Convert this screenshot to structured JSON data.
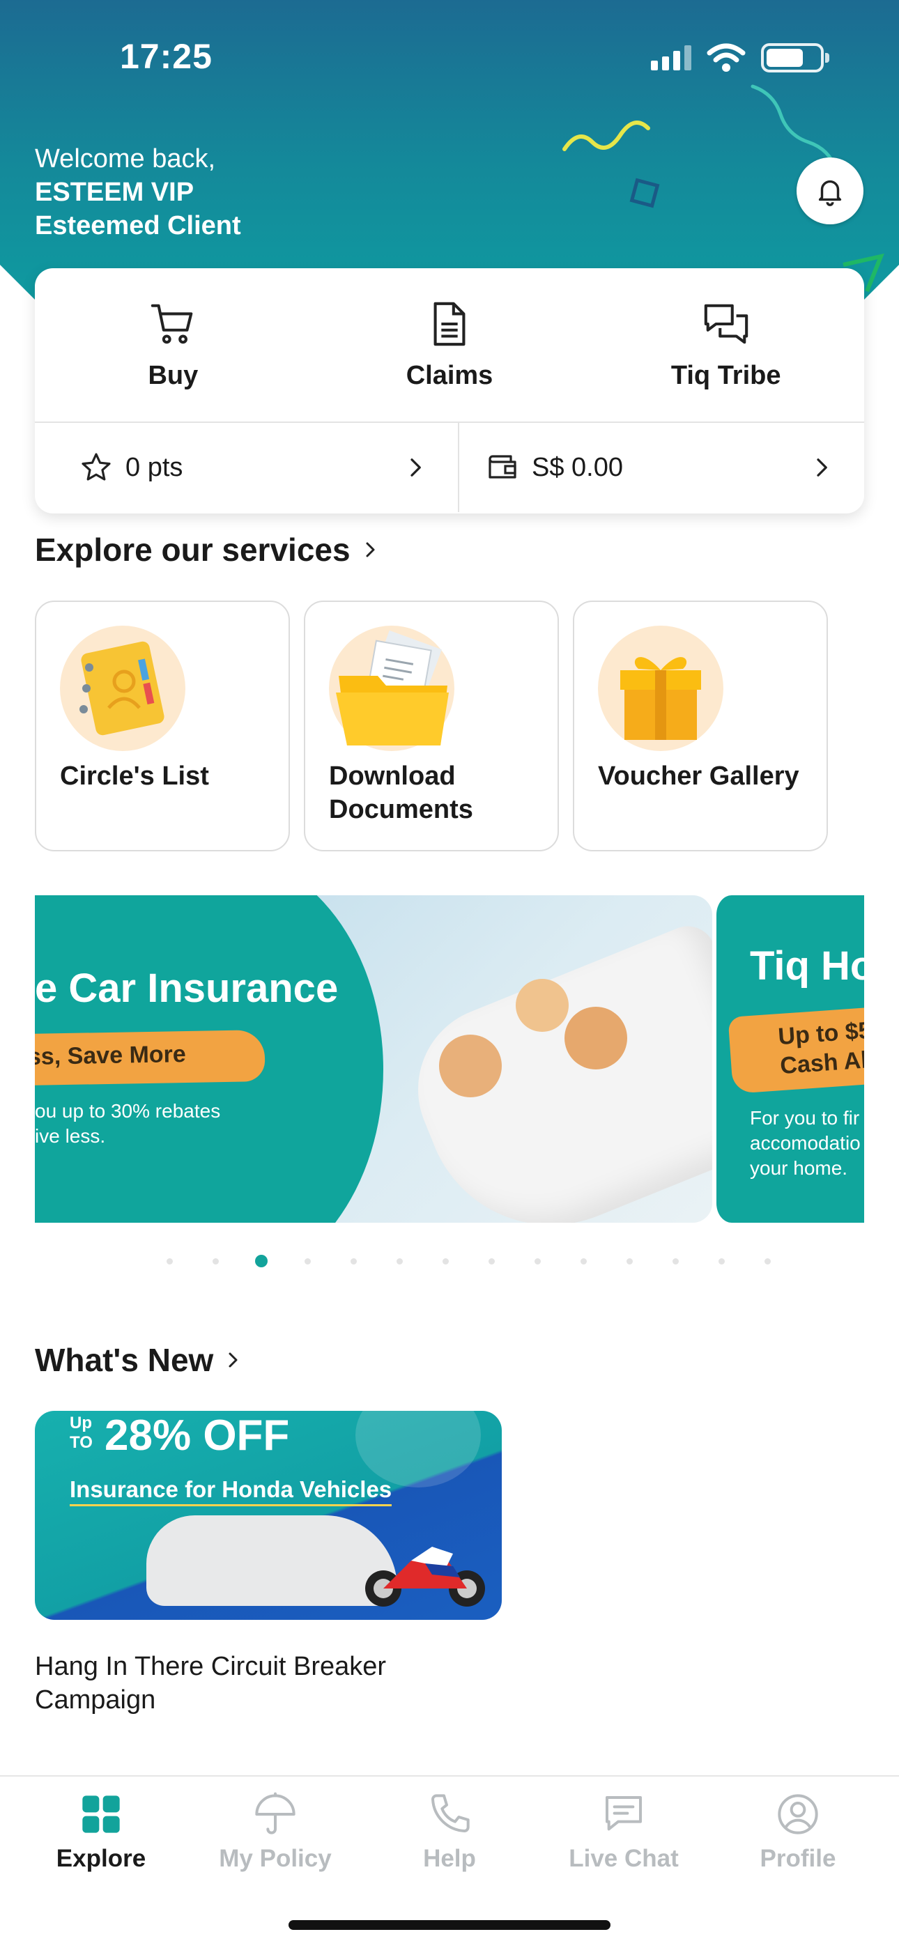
{
  "status_bar": {
    "time": "17:25"
  },
  "colors": {
    "accent": "#12a39b",
    "header_dark": "#1c6b92",
    "header_light": "#0f9aa0",
    "promo_orange": "#f2a342",
    "inactive": "#b8bcbf"
  },
  "header": {
    "welcome_line": "Welcome back,",
    "name_line1": "ESTEEM VIP",
    "name_line2": "Esteemed Client",
    "notification_icon": "bell-icon"
  },
  "quick_actions": [
    {
      "label": "Buy",
      "icon": "cart-icon"
    },
    {
      "label": "Claims",
      "icon": "document-icon"
    },
    {
      "label": "Tiq Tribe",
      "icon": "chat-bubbles-icon"
    }
  ],
  "balances": {
    "points": "0 pts",
    "wallet": "S$ 0.00"
  },
  "services": {
    "title": "Explore our services",
    "items": [
      {
        "label": "Circle's List",
        "icon": "address-book-icon"
      },
      {
        "label": "Download Documents",
        "icon": "folder-icon"
      },
      {
        "label": "Voucher Gallery",
        "icon": "gift-icon"
      }
    ]
  },
  "banners": {
    "current": {
      "title": "e Car Insurance",
      "highlight": "ss, Save More",
      "body": "ou up to 30% rebates\nive less."
    },
    "next": {
      "title": "Tiq Ho",
      "highlight": "Up to $5\nCash All",
      "body": "For you to fir\naccomodatio\nyour home."
    },
    "page_count": 14,
    "active_index": 2
  },
  "whats_new": {
    "title": "What's New",
    "card": {
      "up_to": "Up\nTO",
      "headline": "28% OFF",
      "subtitle": "Insurance for Honda Vehicles"
    },
    "caption": "Hang In There Circuit Breaker\nCampaign"
  },
  "tab_bar": {
    "items": [
      {
        "label": "Explore",
        "icon": "grid-icon",
        "active": true
      },
      {
        "label": "My Policy",
        "icon": "umbrella-icon",
        "active": false
      },
      {
        "label": "Help",
        "icon": "phone-icon",
        "active": false
      },
      {
        "label": "Live Chat",
        "icon": "chat-icon",
        "active": false
      },
      {
        "label": "Profile",
        "icon": "user-circle-icon",
        "active": false
      }
    ]
  }
}
